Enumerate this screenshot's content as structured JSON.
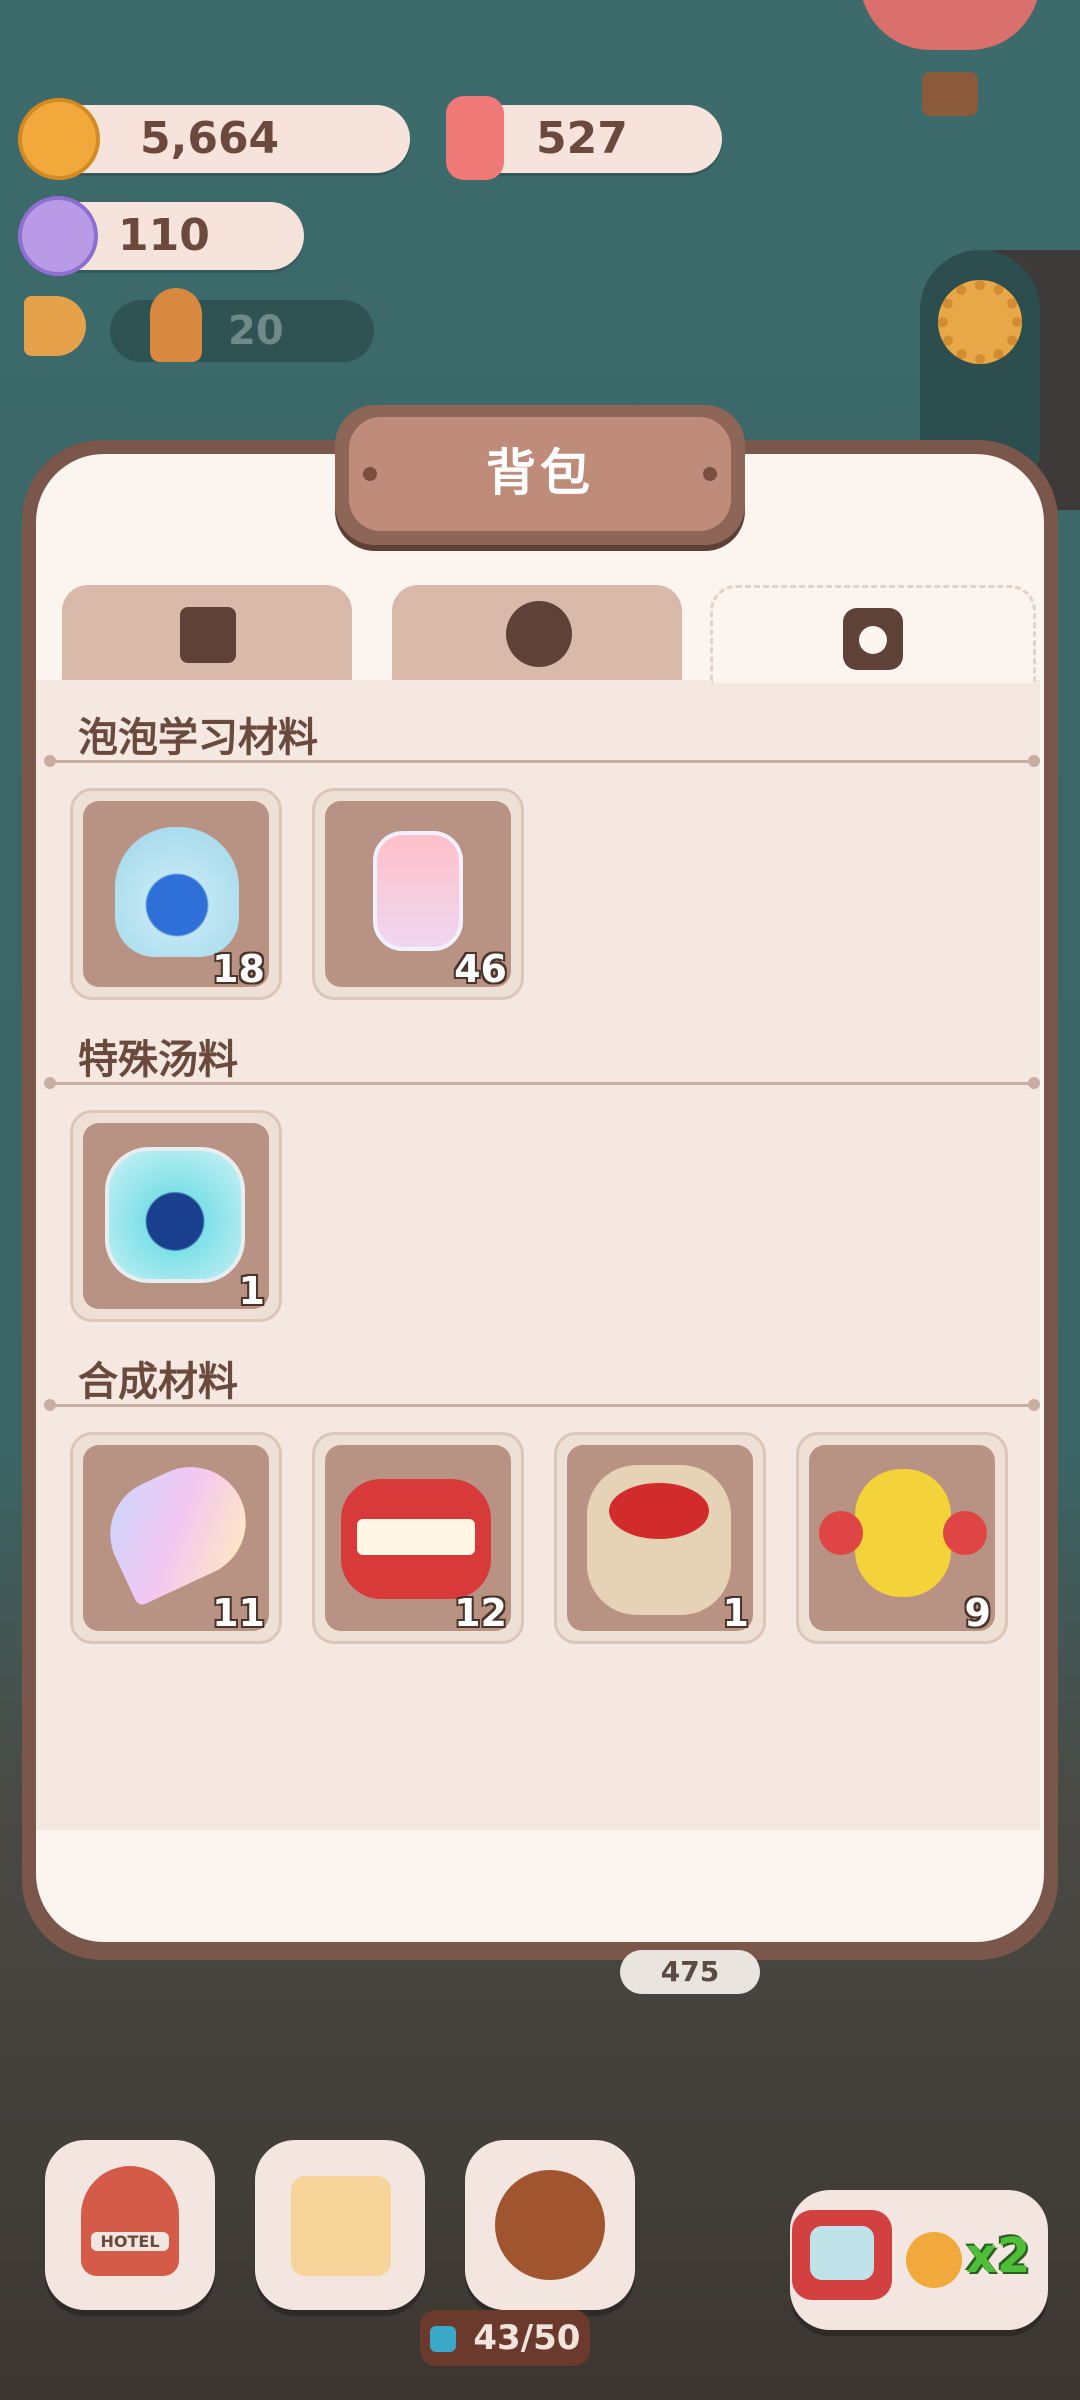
{
  "currencies": {
    "cookies": "5,664",
    "candles": "527",
    "candy": "110",
    "staff": "20"
  },
  "panel": {
    "title": "背包",
    "tabs": [
      {
        "icon": "box-icon",
        "active": false
      },
      {
        "icon": "chef-head-icon",
        "active": false
      },
      {
        "icon": "potion-bag-icon",
        "active": true
      }
    ],
    "sections": [
      {
        "title": "泡泡学习材料",
        "items": [
          {
            "icon": "sparkle-bag-icon",
            "count": "18"
          },
          {
            "icon": "rainbow-bottle-icon",
            "count": "46"
          }
        ]
      },
      {
        "title": "特殊汤料",
        "items": [
          {
            "icon": "galaxy-jar-icon",
            "count": "1"
          }
        ]
      },
      {
        "title": "合成材料",
        "items": [
          {
            "icon": "rainbow-feather-icon",
            "count": "11"
          },
          {
            "icon": "teeth-icon",
            "count": "12"
          },
          {
            "icon": "bean-sack-icon",
            "count": "1"
          },
          {
            "icon": "angry-pineapple-icon",
            "count": "9"
          }
        ]
      }
    ]
  },
  "scene": {
    "sign_number": "475",
    "energy": "43/50",
    "ad_multiplier": "x2",
    "hotel_label": "HOTEL"
  }
}
